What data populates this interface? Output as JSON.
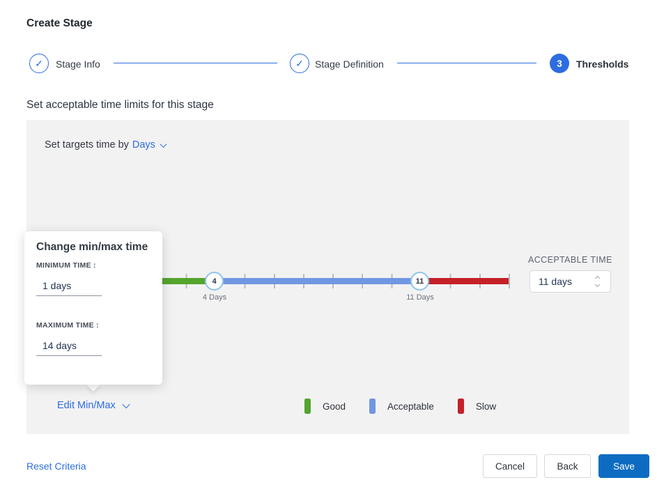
{
  "page": {
    "title": "Create Stage"
  },
  "stepper": {
    "steps": [
      {
        "label": "Stage Info",
        "state": "complete"
      },
      {
        "label": "Stage Definition",
        "state": "complete"
      },
      {
        "label": "Thresholds",
        "state": "active",
        "number": "3"
      }
    ],
    "check_glyph": "✓"
  },
  "section": {
    "heading": "Set acceptable time limits for this stage"
  },
  "panel": {
    "targets_label": "Set targets time by",
    "targets_unit": "Days",
    "slider": {
      "min_handle": {
        "value": "4",
        "label": "4 Days"
      },
      "max_handle": {
        "value": "11",
        "label": "11 Days"
      },
      "range_min_days": 1,
      "range_max_days": 14,
      "colors": {
        "good": "#53a52d",
        "acceptable": "#7097e2",
        "slow": "#c52027"
      }
    },
    "acceptable_time": {
      "label": "ACCEPTABLE TIME",
      "value": "11 days"
    },
    "edit_minmax_label": "Edit Min/Max",
    "legend": [
      {
        "label": "Good",
        "color": "#53a52d"
      },
      {
        "label": "Acceptable",
        "color": "#7097e2"
      },
      {
        "label": "Slow",
        "color": "#c52027"
      }
    ]
  },
  "popover": {
    "title": "Change min/max time",
    "min_label": "MINIMUM TIME :",
    "min_value": "1 days",
    "max_label": "MAXIMUM TIME :",
    "max_value": "14 days"
  },
  "footer": {
    "reset_label": "Reset Criteria",
    "cancel_label": "Cancel",
    "back_label": "Back",
    "save_label": "Save"
  },
  "colors": {
    "accent_blue": "#2d6ce0",
    "save_blue": "#0d6cc2",
    "panel_bg": "#f2f2f3",
    "handle_border": "#8fc4ea",
    "tick_gray": "#b9bcc0"
  }
}
